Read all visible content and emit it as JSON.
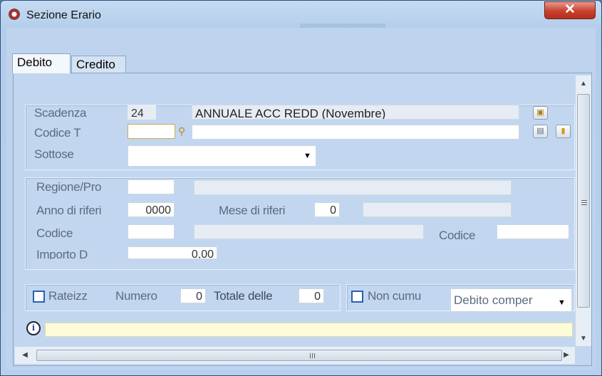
{
  "window": {
    "title": "Sezione Erario",
    "close_glyph": "✕"
  },
  "tabs": [
    {
      "label": "Debito",
      "active": true
    },
    {
      "label": "Credito",
      "active": false
    }
  ],
  "form": {
    "scadenza": {
      "label": "Scadenza",
      "code": "24",
      "description": "ANNUALE ACC REDD (Novembre)"
    },
    "codice_tributo": {
      "label": "Codice T",
      "value": "",
      "description": ""
    },
    "sottosezione": {
      "label": "Sottose",
      "value": ""
    },
    "regione": {
      "label": "Regione/Pro",
      "value": "",
      "description": ""
    },
    "anno": {
      "label": "Anno di riferi",
      "value": "0000"
    },
    "mese": {
      "label": "Mese di riferi",
      "value": "0",
      "description": ""
    },
    "codice1": {
      "label": "Codice",
      "value": "",
      "description": ""
    },
    "codice2": {
      "label": "Codice",
      "value": ""
    },
    "importo": {
      "label": "Importo D",
      "value": "0,00"
    },
    "rateizzazione": {
      "label": "Rateizz",
      "checked": false
    },
    "numero": {
      "label": "Numero",
      "value": "0"
    },
    "totale": {
      "label": "Totale delle",
      "value": "0"
    },
    "non_cumulabile": {
      "label": "Non cumu",
      "checked": false
    },
    "debito_compensato": {
      "value": "Debito comper"
    }
  },
  "message_bar": {
    "text": ""
  },
  "scrollbars": {
    "grip": "III"
  }
}
